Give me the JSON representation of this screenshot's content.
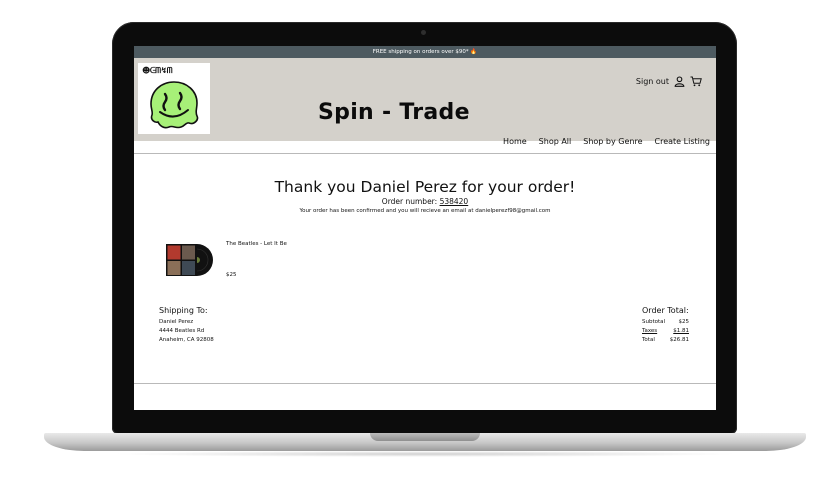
{
  "promo": {
    "text": "FREE shipping on orders over $90* 🔥"
  },
  "header": {
    "logo_text": "☻ᕮᗰ↯ᗰ",
    "title": "Spin - Trade",
    "sign_out_label": "Sign out"
  },
  "nav": {
    "items": [
      {
        "label": "Home"
      },
      {
        "label": "Shop All"
      },
      {
        "label": "Shop by Genre"
      },
      {
        "label": "Create Listing"
      }
    ]
  },
  "confirmation": {
    "heading": "Thank you Daniel Perez for your order!",
    "order_number_label": "Order number:",
    "order_number": "538420",
    "message": "Your order has been confirmed and you will recieve an email at danielperezf98@gmail.com"
  },
  "item": {
    "title": "The Beatles - Let It Be",
    "price": "$25"
  },
  "shipping": {
    "heading": "Shipping To:",
    "name": "Daniel Perez",
    "street": "4444 Beatles Rd",
    "city": "Anaheim, CA 92808"
  },
  "totals": {
    "heading": "Order Total:",
    "subtotal_label": "Subtotal",
    "subtotal": "$25",
    "taxes_label": "Taxes",
    "taxes": "$1.81",
    "total_label": "Total",
    "total": "$26.81"
  },
  "colors": {
    "header_bg": "#d4d1cb",
    "promo_bg": "#4d5a60",
    "smiley": "#a7f078"
  }
}
